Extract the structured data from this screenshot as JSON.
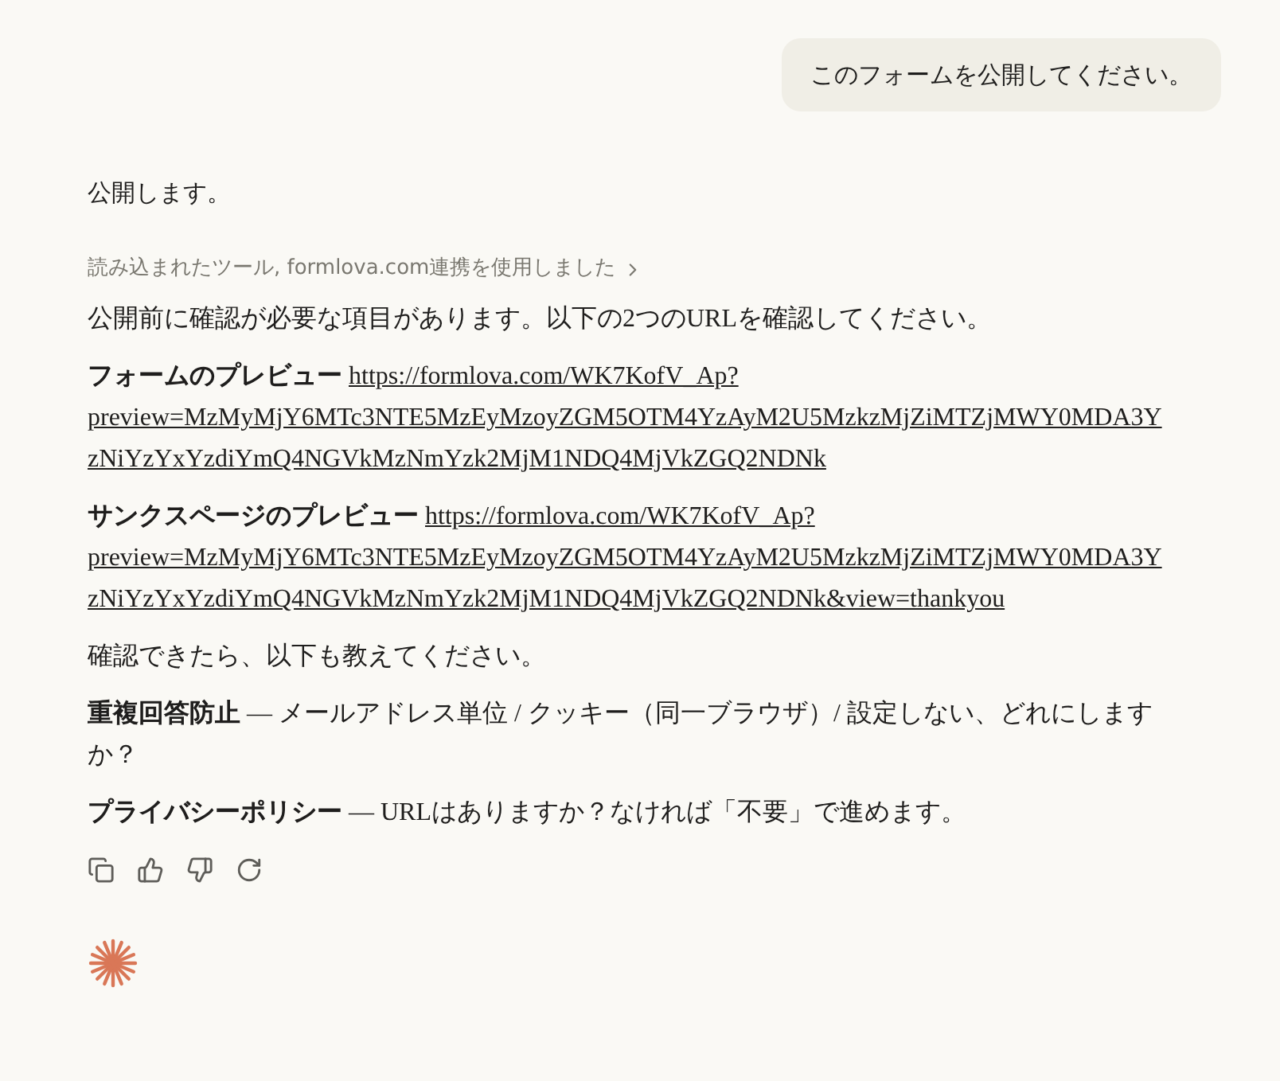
{
  "user_message": "このフォームを公開してください。",
  "reply_intro": "公開します。",
  "tool_use": {
    "label": "読み込まれたツール, formlova.com連携を使用しました",
    "expanded": false
  },
  "lead": "公開前に確認が必要な項目があります。以下の2つのURLを確認してください。",
  "links": [
    {
      "label": "フォームのプレビュー",
      "url": "https://formlova.com/WK7KofV_Ap?preview=MzMyMjY6MTc3NTE5MzEyMzoyZGM5OTM4YzAyM2U5MzkzMjZiMTZjMWY0MDA3YzNiYzYxYzdiYmQ4NGVkMzNmYzk2MjM1NDQ4MjVkZGQ2NDNk"
    },
    {
      "label": "サンクスページのプレビュー",
      "url": "https://formlova.com/WK7KofV_Ap?preview=MzMyMjY6MTc3NTE5MzEyMzoyZGM5OTM4YzAyM2U5MzkzMjZiMTZjMWY0MDA3YzNiYzYxYzdiYmQ4NGVkMzNmYzk2MjM1NDQ4MjVkZGQ2NDNk&view=thankyou"
    }
  ],
  "followup": "確認できたら、以下も教えてください。",
  "questions": [
    "**重複回答防止** — メールアドレス単位 / クッキー（同一ブラウザ）/ 設定しない、どれにしますか？",
    "**プライバシーポリシー** — URLはありますか？なければ「不要」で進めます。"
  ]
}
